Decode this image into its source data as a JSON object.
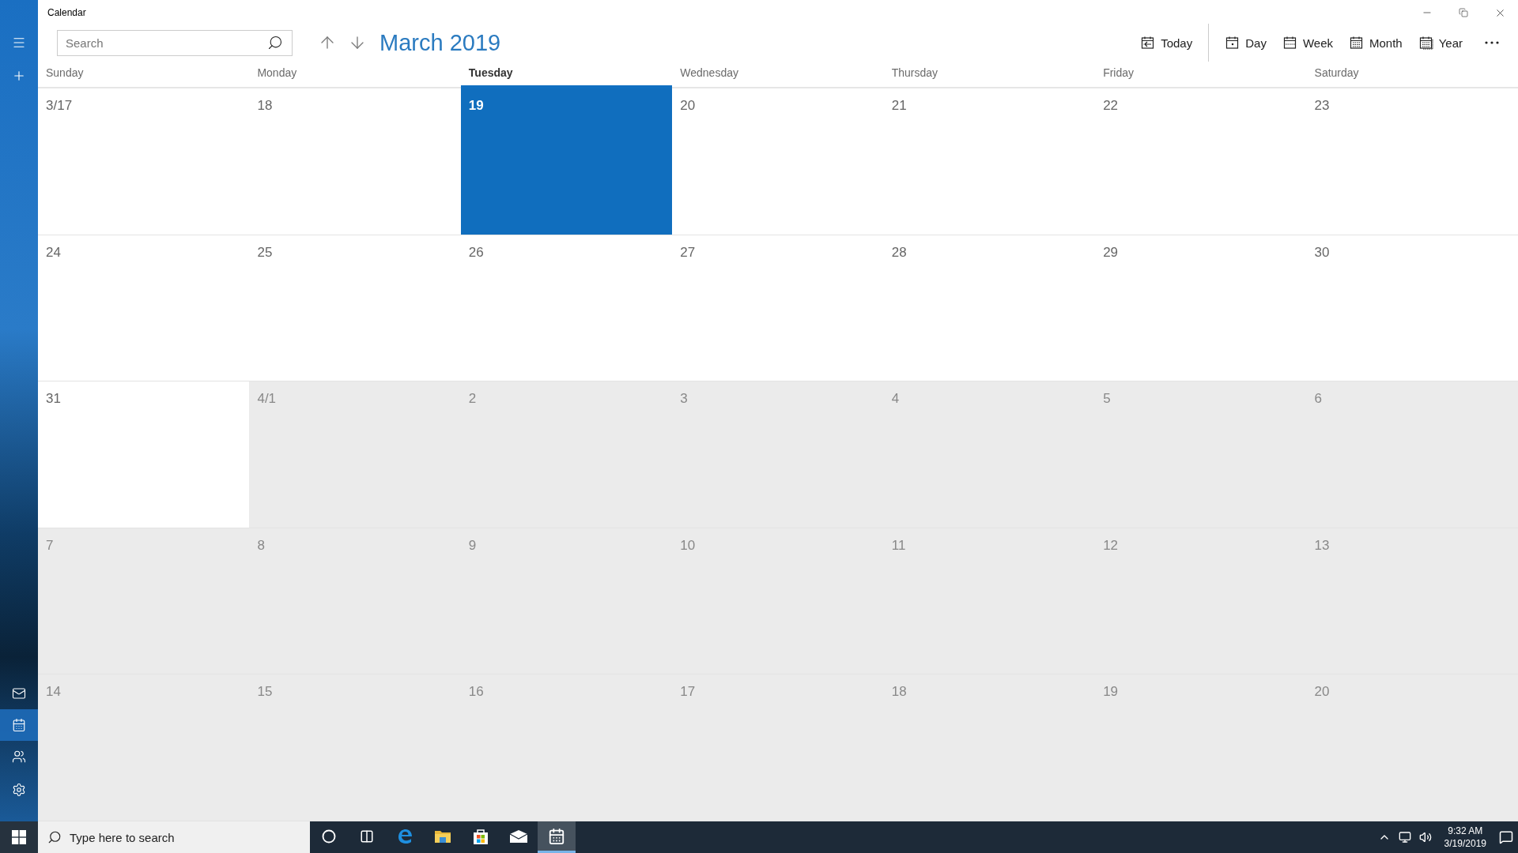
{
  "window": {
    "title": "Calendar"
  },
  "sidebar": {
    "top": [
      {
        "kind": "menu"
      },
      {
        "kind": "add"
      }
    ],
    "bottom": [
      {
        "kind": "mail",
        "selected": false
      },
      {
        "kind": "calendar",
        "selected": true
      },
      {
        "kind": "people",
        "selected": false
      },
      {
        "kind": "settings",
        "selected": false
      }
    ]
  },
  "toolbar": {
    "search": {
      "placeholder": "Search"
    },
    "title": "March 2019",
    "views": [
      {
        "kind": "today",
        "label": "Today"
      },
      {
        "kind": "day",
        "label": "Day"
      },
      {
        "kind": "week",
        "label": "Week"
      },
      {
        "kind": "month",
        "label": "Month"
      },
      {
        "kind": "year",
        "label": "Year"
      }
    ]
  },
  "weekdays": [
    {
      "label": "Sunday",
      "selected": false
    },
    {
      "label": "Monday",
      "selected": false
    },
    {
      "label": "Tuesday",
      "selected": true
    },
    {
      "label": "Wednesday",
      "selected": false
    },
    {
      "label": "Thursday",
      "selected": false
    },
    {
      "label": "Friday",
      "selected": false
    },
    {
      "label": "Saturday",
      "selected": false
    }
  ],
  "weeks": [
    [
      {
        "label": "3/17",
        "in_month": true,
        "selected": false
      },
      {
        "label": "18",
        "in_month": true,
        "selected": false
      },
      {
        "label": "19",
        "in_month": true,
        "selected": true
      },
      {
        "label": "20",
        "in_month": true,
        "selected": false
      },
      {
        "label": "21",
        "in_month": true,
        "selected": false
      },
      {
        "label": "22",
        "in_month": true,
        "selected": false
      },
      {
        "label": "23",
        "in_month": true,
        "selected": false
      }
    ],
    [
      {
        "label": "24",
        "in_month": true,
        "selected": false
      },
      {
        "label": "25",
        "in_month": true,
        "selected": false
      },
      {
        "label": "26",
        "in_month": true,
        "selected": false
      },
      {
        "label": "27",
        "in_month": true,
        "selected": false
      },
      {
        "label": "28",
        "in_month": true,
        "selected": false
      },
      {
        "label": "29",
        "in_month": true,
        "selected": false
      },
      {
        "label": "30",
        "in_month": true,
        "selected": false
      }
    ],
    [
      {
        "label": "31",
        "in_month": true,
        "selected": false
      },
      {
        "label": "4/1",
        "in_month": false,
        "selected": false
      },
      {
        "label": "2",
        "in_month": false,
        "selected": false
      },
      {
        "label": "3",
        "in_month": false,
        "selected": false
      },
      {
        "label": "4",
        "in_month": false,
        "selected": false
      },
      {
        "label": "5",
        "in_month": false,
        "selected": false
      },
      {
        "label": "6",
        "in_month": false,
        "selected": false
      }
    ],
    [
      {
        "label": "7",
        "in_month": false,
        "selected": false
      },
      {
        "label": "8",
        "in_month": false,
        "selected": false
      },
      {
        "label": "9",
        "in_month": false,
        "selected": false
      },
      {
        "label": "10",
        "in_month": false,
        "selected": false
      },
      {
        "label": "11",
        "in_month": false,
        "selected": false
      },
      {
        "label": "12",
        "in_month": false,
        "selected": false
      },
      {
        "label": "13",
        "in_month": false,
        "selected": false
      }
    ],
    [
      {
        "label": "14",
        "in_month": false,
        "selected": false
      },
      {
        "label": "15",
        "in_month": false,
        "selected": false
      },
      {
        "label": "16",
        "in_month": false,
        "selected": false
      },
      {
        "label": "17",
        "in_month": false,
        "selected": false
      },
      {
        "label": "18",
        "in_month": false,
        "selected": false
      },
      {
        "label": "19",
        "in_month": false,
        "selected": false
      },
      {
        "label": "20",
        "in_month": false,
        "selected": false
      }
    ]
  ],
  "taskbar": {
    "search": {
      "placeholder": "Type here to search"
    },
    "apps": [
      {
        "kind": "cortana",
        "active": false
      },
      {
        "kind": "taskview",
        "active": false
      },
      {
        "kind": "edge",
        "active": false
      },
      {
        "kind": "explorer",
        "active": false
      },
      {
        "kind": "store",
        "active": false
      },
      {
        "kind": "mail",
        "active": false
      },
      {
        "kind": "calendar",
        "active": true
      }
    ],
    "time": "9:32 AM",
    "date": "3/19/2019"
  }
}
